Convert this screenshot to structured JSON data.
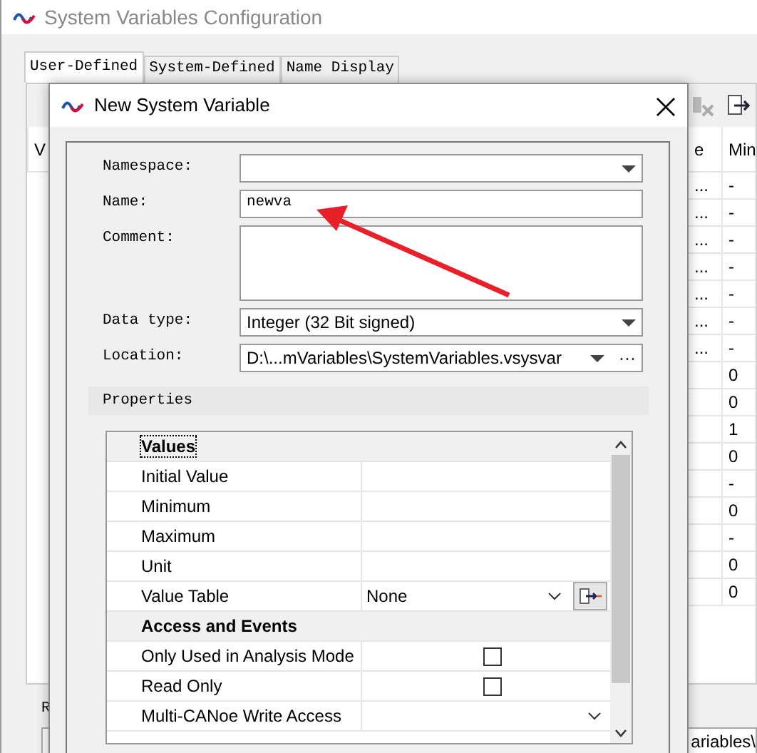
{
  "window": {
    "title": "System Variables Configuration"
  },
  "tabs": [
    {
      "label": "User-Defined",
      "selected": true
    },
    {
      "label": "System-Defined",
      "selected": false
    },
    {
      "label": "Name Display",
      "selected": false
    }
  ],
  "background_table": {
    "columns": [
      "V",
      "e",
      "Min"
    ],
    "rows": [
      {
        "column_2": "...",
        "column_3": "-"
      },
      {
        "column_2": "...",
        "column_3": "-"
      },
      {
        "column_2": "...",
        "column_3": "-"
      },
      {
        "column_2": "...",
        "column_3": "-"
      },
      {
        "column_2": "...",
        "column_3": "-"
      },
      {
        "column_2": "...",
        "column_3": "-"
      },
      {
        "column_2": "...",
        "column_3": "-"
      },
      {
        "column_3": "0"
      },
      {
        "column_3": "0"
      },
      {
        "column_3": "1"
      },
      {
        "column_3": "0"
      },
      {
        "column_3": "-"
      },
      {
        "column_3": "0"
      },
      {
        "column_3": "-"
      },
      {
        "column_3": "0"
      },
      {
        "column_3": "0"
      }
    ]
  },
  "bottom_label": "R",
  "bottom_field": {
    "value": "ariables\\"
  },
  "dialog": {
    "title": "New System Variable",
    "fields": [
      {
        "label": "Namespace:",
        "kind": "dropdown"
      },
      {
        "label": "Name:",
        "kind": "text",
        "value": "newva"
      },
      {
        "label": "Comment:",
        "kind": "textarea"
      },
      {
        "label": "Data type:",
        "kind": "dropdown",
        "value": "Integer (32 Bit signed)"
      },
      {
        "label": "Location:",
        "kind": "path",
        "value": "D:\\...mVariables\\SystemVariables.vsysvar",
        "browse": "···"
      }
    ],
    "properties_title": "Properties",
    "property_rows": [
      {
        "kind": "category",
        "label": "Values",
        "focused": true
      },
      {
        "kind": "text",
        "label": "Initial Value"
      },
      {
        "kind": "text",
        "label": "Minimum"
      },
      {
        "kind": "text",
        "label": "Maximum"
      },
      {
        "kind": "text",
        "label": "Unit"
      },
      {
        "kind": "dropdown",
        "label": "Value Table",
        "value": "None",
        "button": true
      },
      {
        "kind": "category",
        "label": "Access and Events",
        "focused": false
      },
      {
        "kind": "checkbox",
        "label": "Only Used in Analysis Mode",
        "checked": false
      },
      {
        "kind": "checkbox",
        "label": "Read Only",
        "checked": false
      },
      {
        "kind": "dropdown",
        "label": "Multi-CANoe Write Access"
      }
    ]
  }
}
